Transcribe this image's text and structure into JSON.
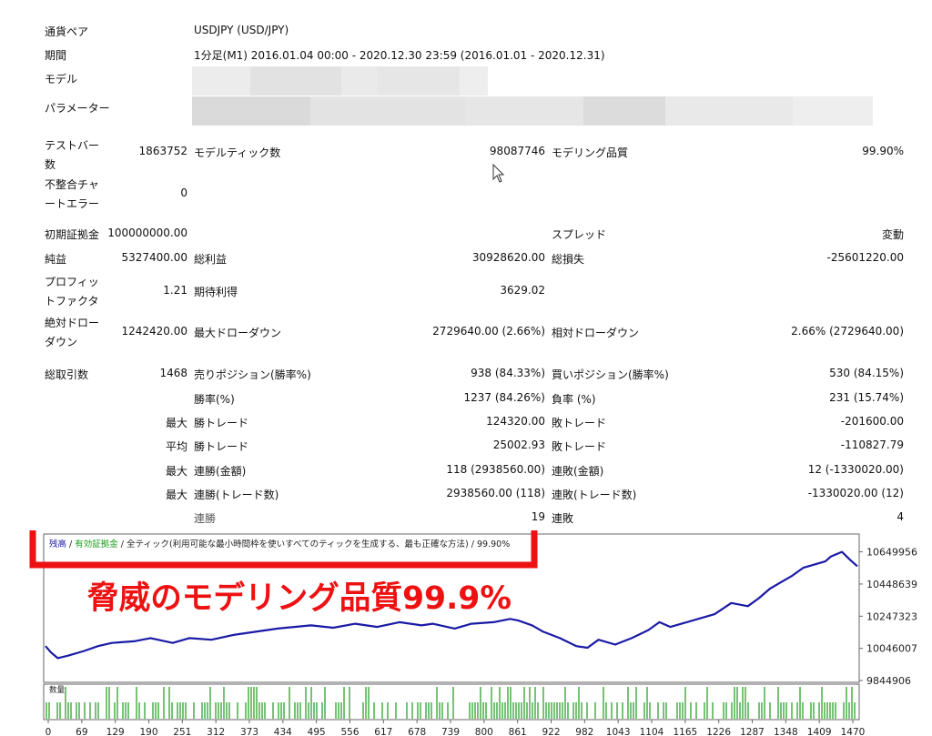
{
  "report": {
    "currency_pair": {
      "label": "通貨ペア",
      "value": "USDJPY (USD/JPY)"
    },
    "period": {
      "label": "期間",
      "value": "1分足(M1) 2016.01.04 00:00 - 2020.12.30 23:59 (2016.01.01 - 2020.12.31)"
    },
    "model": {
      "label": "モデル"
    },
    "parameters": {
      "label": "パラメーター"
    },
    "test_bars": {
      "label_line1": "テストバー",
      "label_line2": "数",
      "value": "1863752"
    },
    "model_ticks": {
      "label": "モデルティック数",
      "value": "98087746"
    },
    "modeling_quality": {
      "label": "モデリング品質",
      "value": "99.90%"
    },
    "mismatch_errors": {
      "label_line1": "不整合チャ",
      "label_line2": "ートエラー",
      "value": "0"
    },
    "initial_deposit": {
      "label": "初期証拠金",
      "value": "100000000.00"
    },
    "spread": {
      "label": "スプレッド",
      "value": "変動"
    },
    "net_profit": {
      "label": "純益",
      "value": "5327400.00"
    },
    "gross_profit": {
      "label": "総利益",
      "value": "30928620.00"
    },
    "gross_loss": {
      "label": "総損失",
      "value": "-25601220.00"
    },
    "profit_factor": {
      "label_line1": "プロフィッ",
      "label_line2": "トファクタ",
      "value": "1.21"
    },
    "expected_payoff": {
      "label": "期待利得",
      "value": "3629.02"
    },
    "absolute_drawdown": {
      "label_line1": "絶対ドロー",
      "label_line2": "ダウン",
      "value": "1242420.00"
    },
    "maximal_drawdown": {
      "label": "最大ドローダウン",
      "value": "2729640.00 (2.66%)"
    },
    "relative_drawdown": {
      "label": "相対ドローダウン",
      "value": "2.66% (2729640.00)"
    },
    "total_trades": {
      "label": "総取引数",
      "value": "1468"
    },
    "short_positions": {
      "label": "売りポジション(勝率%)",
      "value": "938 (84.33%)"
    },
    "long_positions": {
      "label": "買いポジション(勝率%)",
      "value": "530 (84.15%)"
    },
    "win_rate": {
      "label": "勝率(%)",
      "value": "1237 (84.26%)"
    },
    "loss_rate": {
      "label": "負率 (%)",
      "value": "231 (15.74%)"
    },
    "largest_win": {
      "prefix": "最大",
      "label": "勝トレード",
      "value": "124320.00"
    },
    "largest_loss": {
      "label": "敗トレード",
      "value": "-201600.00"
    },
    "average_win": {
      "prefix": "平均",
      "label": "勝トレード",
      "value": "25002.93"
    },
    "average_loss": {
      "label": "敗トレード",
      "value": "-110827.79"
    },
    "max_consec_wins_money": {
      "prefix": "最大",
      "label": "連勝(金額)",
      "value": "118 (2938560.00)"
    },
    "max_consec_losses_money": {
      "label": "連敗(金額)",
      "value": "12 (-1330020.00)"
    },
    "max_consec_profit_count": {
      "prefix": "最大",
      "label": "連勝(トレード数)",
      "value": "2938560.00 (118)"
    },
    "max_consec_loss_count": {
      "label": "連敗(トレード数)",
      "value": "-1330020.00 (12)"
    },
    "avg_consec_wins": {
      "label": "連勝",
      "value": "19"
    },
    "avg_consec_losses": {
      "label": "連敗",
      "value": "4"
    }
  },
  "chart_data": {
    "type": "line",
    "legend": {
      "balance": "残高",
      "sep1": " / ",
      "equity": "有効証拠金",
      "sep2": " / ",
      "ticks": "全ティック(利用可能な最小時間枠を使いすべてのティックを生成する、最も正確な方法)",
      "quality": " / 99.90%"
    },
    "annotation": "脅威のモデリング品質99.9%",
    "volume_label": "数量",
    "yticks": [
      10649956,
      10448639,
      10247323,
      10046007,
      9844906
    ],
    "xticks": [
      "0",
      "69",
      "129",
      "190",
      "251",
      "312",
      "373",
      "434",
      "495",
      "556",
      "617",
      "678",
      "739",
      "800",
      "861",
      "922",
      "982",
      "1043",
      "1104",
      "1165",
      "1226",
      "1287",
      "1348",
      "1409",
      "1470"
    ],
    "xlim": [
      0,
      1468
    ],
    "ylim": [
      9844906,
      10750000
    ],
    "series": [
      {
        "x": [
          0,
          10,
          22,
          40,
          70,
          95,
          120,
          160,
          190,
          230,
          260,
          300,
          340,
          380,
          420,
          450,
          480,
          520,
          560,
          600,
          640,
          680,
          700,
          740,
          770,
          810,
          840,
          855,
          880,
          900,
          930,
          960,
          980,
          1000,
          1030,
          1060,
          1090,
          1110,
          1130,
          1150,
          1180,
          1210,
          1240,
          1270,
          1290,
          1310,
          1330,
          1350,
          1370,
          1390,
          1410,
          1420,
          1440,
          1455,
          1468
        ],
        "values": [
          10060000,
          10020000,
          9985000,
          10000000,
          10030000,
          10060000,
          10080000,
          10090000,
          10110000,
          10080000,
          10110000,
          10100000,
          10130000,
          10150000,
          10170000,
          10180000,
          10190000,
          10175000,
          10200000,
          10180000,
          10210000,
          10190000,
          10200000,
          10170000,
          10200000,
          10210000,
          10230000,
          10220000,
          10190000,
          10150000,
          10110000,
          10060000,
          10050000,
          10100000,
          10070000,
          10110000,
          10160000,
          10210000,
          10180000,
          10200000,
          10230000,
          10260000,
          10330000,
          10310000,
          10360000,
          10420000,
          10460000,
          10500000,
          10550000,
          10570000,
          10590000,
          10620000,
          10650000,
          10600000,
          10560000
        ]
      }
    ]
  }
}
